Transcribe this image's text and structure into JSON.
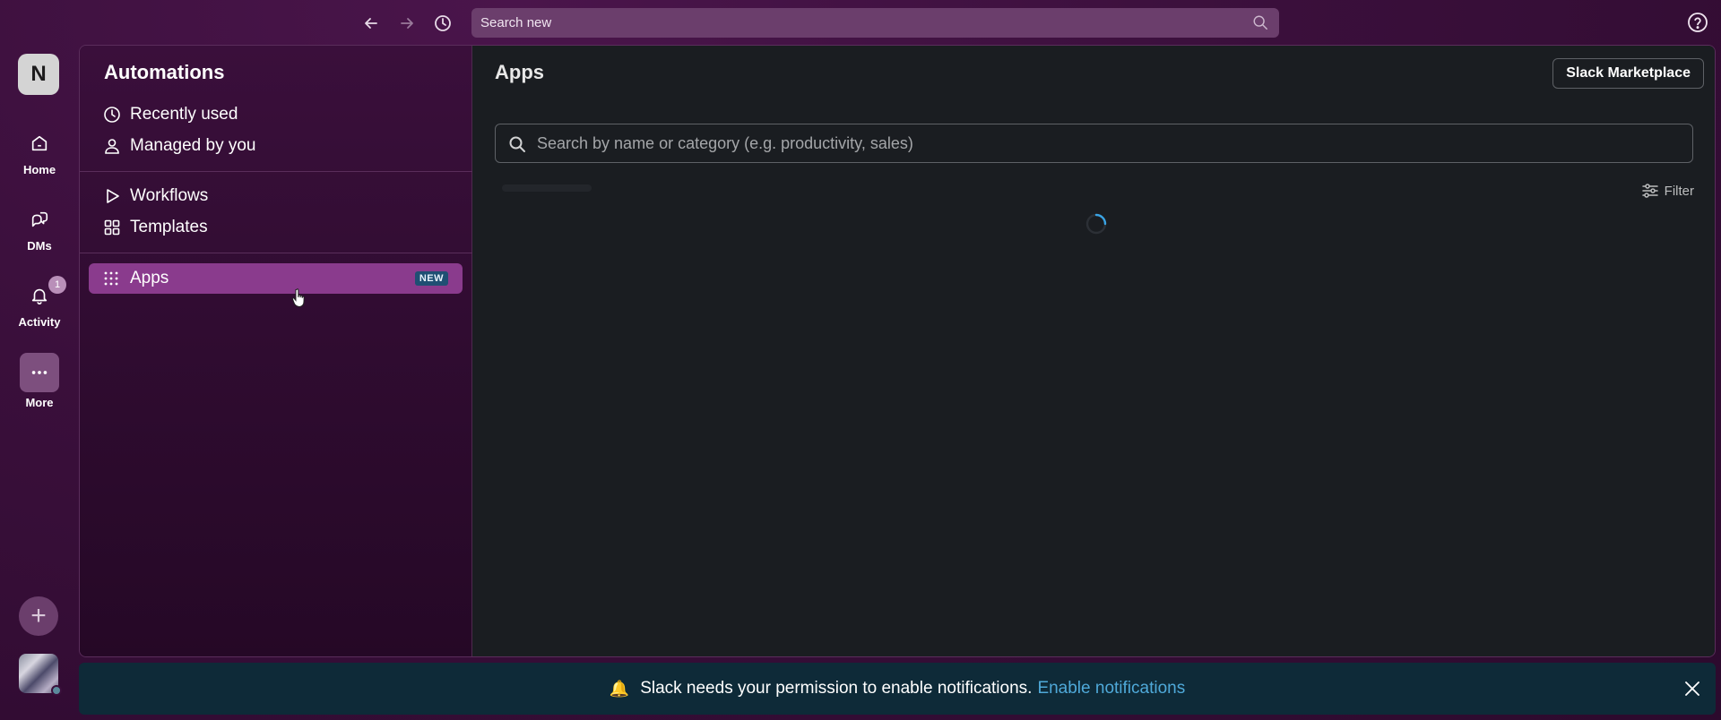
{
  "topbar": {
    "back_icon": "arrow-left-icon",
    "forward_icon": "arrow-right-icon",
    "history_icon": "clock-icon",
    "search_placeholder": "Search new",
    "help_icon": "help-circle-icon"
  },
  "rail": {
    "workspace_initial": "N",
    "items": [
      {
        "label": "Home",
        "icon": "home-icon"
      },
      {
        "label": "DMs",
        "icon": "dms-icon"
      },
      {
        "label": "Activity",
        "icon": "bell-icon",
        "badge": "1"
      },
      {
        "label": "More",
        "icon": "ellipsis-icon"
      }
    ],
    "add_label": "+"
  },
  "sidebar": {
    "title": "Automations",
    "items": [
      {
        "label": "Recently used",
        "icon": "clock-icon"
      },
      {
        "label": "Managed by you",
        "icon": "person-icon"
      },
      {
        "label": "Workflows",
        "icon": "play-icon"
      },
      {
        "label": "Templates",
        "icon": "grid-icon"
      }
    ],
    "active": {
      "label": "Apps",
      "icon": "apps-grid-icon",
      "tag": "NEW"
    },
    "active_color": "#8a3b8d"
  },
  "content": {
    "title": "Apps",
    "marketplace_button": "Slack Marketplace",
    "search_placeholder": "Search by name or category (e.g. productivity, sales)",
    "filter_label": "Filter",
    "loading": true
  },
  "notice": {
    "message": "Slack needs your permission to enable notifications.",
    "link": "Enable notifications",
    "link_color": "#4fa9d9",
    "icon": "bell-emoji-icon",
    "close_icon": "close-icon"
  }
}
